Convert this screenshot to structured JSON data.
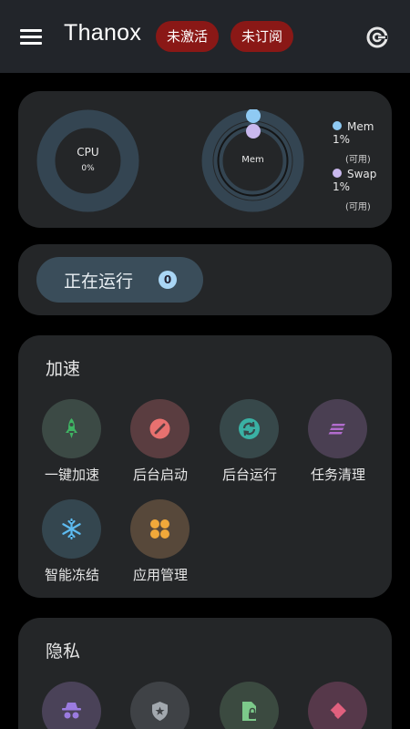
{
  "appbar": {
    "title": "Thanox",
    "badge_inactive": "未激活",
    "badge_unsubscribed": "未订阅"
  },
  "stats": {
    "cpu_label": "CPU",
    "cpu_value": "0%",
    "mem_gauge_label": "Mem",
    "legend": [
      {
        "label": "Mem 1%",
        "sub": "(可用)",
        "color": "#8fcaf3"
      },
      {
        "label": "Swap 1%",
        "sub": "(可用)",
        "color": "#c9b8ee"
      }
    ]
  },
  "running": {
    "label": "正在运行",
    "count": "0"
  },
  "boost": {
    "title": "加速",
    "items": [
      {
        "label": "一键加速",
        "icon": "rocket-icon"
      },
      {
        "label": "后台启动",
        "icon": "block-icon"
      },
      {
        "label": "后台运行",
        "icon": "sync-icon"
      },
      {
        "label": "任务清理",
        "icon": "clean-icon"
      },
      {
        "label": "智能冻结",
        "icon": "snowflake-icon"
      },
      {
        "label": "应用管理",
        "icon": "apps-grid-icon"
      }
    ]
  },
  "privacy": {
    "title": "隐私"
  },
  "colors": {
    "accent": "#8a1816",
    "card": "#242628",
    "appbar": "#22252a"
  }
}
